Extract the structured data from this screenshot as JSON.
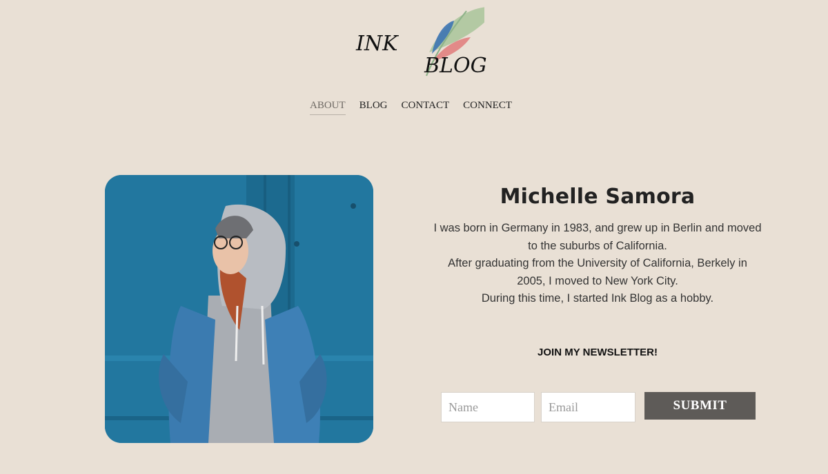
{
  "logo": {
    "word_top": "INK",
    "word_bottom": "BLOG"
  },
  "nav": {
    "items": [
      {
        "label": "ABOUT",
        "active": true
      },
      {
        "label": "BLOG",
        "active": false
      },
      {
        "label": "CONTACT",
        "active": false
      },
      {
        "label": "CONNECT",
        "active": false
      }
    ]
  },
  "profile": {
    "name": "Michelle Samora",
    "bio_lines": [
      "I was born in Germany in 1983, and grew up in Berlin and moved",
      "to the suburbs of California.",
      "After graduating from the University of California, Berkely in",
      "2005, I moved to New York City.",
      "During this time, I started Ink Blog as a hobby."
    ]
  },
  "newsletter": {
    "title": "JOIN MY NEWSLETTER!",
    "name_placeholder": "Name",
    "email_placeholder": "Email",
    "submit_label": "SUBMIT"
  },
  "colors": {
    "background": "#e9e0d5",
    "submit_bg": "#5e5b58",
    "photo_wall": "#1f6f95"
  }
}
